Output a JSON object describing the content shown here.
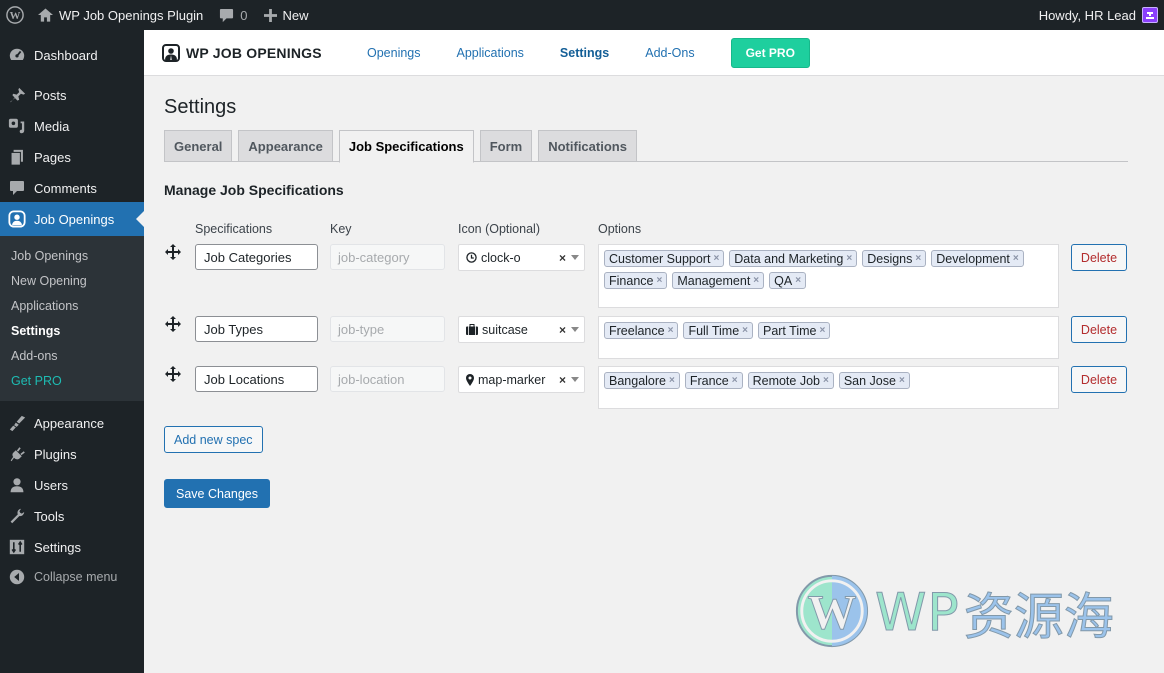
{
  "adminbar": {
    "site_name": "WP Job Openings Plugin",
    "comments_count": "0",
    "new_label": "New",
    "howdy": "Howdy, HR Lead"
  },
  "sidebar": {
    "items_top": [
      {
        "label": "Dashboard",
        "icon": "dashboard-icon"
      },
      {
        "label": "Posts",
        "icon": "pin-icon"
      },
      {
        "label": "Media",
        "icon": "media-icon"
      },
      {
        "label": "Pages",
        "icon": "pages-icon"
      },
      {
        "label": "Comments",
        "icon": "comment-icon"
      }
    ],
    "current": {
      "label": "Job Openings",
      "icon": "job-openings-icon"
    },
    "submenu": [
      {
        "label": "Job Openings"
      },
      {
        "label": "New Opening"
      },
      {
        "label": "Applications"
      },
      {
        "label": "Settings",
        "active": true
      },
      {
        "label": "Add-ons"
      },
      {
        "label": "Get PRO"
      }
    ],
    "items_bottom": [
      {
        "label": "Appearance",
        "icon": "paintbrush-icon"
      },
      {
        "label": "Plugins",
        "icon": "plugin-icon"
      },
      {
        "label": "Users",
        "icon": "users-icon"
      },
      {
        "label": "Tools",
        "icon": "wrench-icon"
      },
      {
        "label": "Settings",
        "icon": "settings-icon"
      }
    ],
    "collapse_label": "Collapse menu"
  },
  "plugin_header": {
    "brand": "WP JOB OPENINGS",
    "nav": [
      {
        "label": "Openings"
      },
      {
        "label": "Applications"
      },
      {
        "label": "Settings",
        "active": true
      },
      {
        "label": "Add-Ons"
      }
    ],
    "get_pro": "Get PRO"
  },
  "main": {
    "title": "Settings",
    "tabs": [
      {
        "label": "General"
      },
      {
        "label": "Appearance"
      },
      {
        "label": "Job Specifications",
        "active": true
      },
      {
        "label": "Form"
      },
      {
        "label": "Notifications"
      }
    ],
    "section_title": "Manage Job Specifications",
    "columns": {
      "specifications": "Specifications",
      "key": "Key",
      "icon": "Icon (Optional)",
      "options": "Options"
    },
    "specs": [
      {
        "name": "Job Categories",
        "key": "job-category",
        "icon": "clock-o",
        "options": [
          "Customer Support",
          "Data and Marketing",
          "Designs",
          "Development",
          "Finance",
          "Management",
          "QA"
        ],
        "delete": "Delete"
      },
      {
        "name": "Job Types",
        "key": "job-type",
        "icon": "suitcase",
        "options": [
          "Freelance",
          "Full Time",
          "Part Time"
        ],
        "delete": "Delete"
      },
      {
        "name": "Job Locations",
        "key": "job-location",
        "icon": "map-marker",
        "options": [
          "Bangalore",
          "France",
          "Remote Job",
          "San Jose"
        ],
        "delete": "Delete"
      }
    ],
    "add_spec": "Add new spec",
    "save": "Save Changes"
  },
  "watermark": {
    "en": "WP",
    "cn": "资源海"
  },
  "colors": {
    "admin_dark": "#1d2327",
    "accent": "#2271b1",
    "get_pro": "#1ecf9e",
    "delete": "#b32d2e"
  }
}
